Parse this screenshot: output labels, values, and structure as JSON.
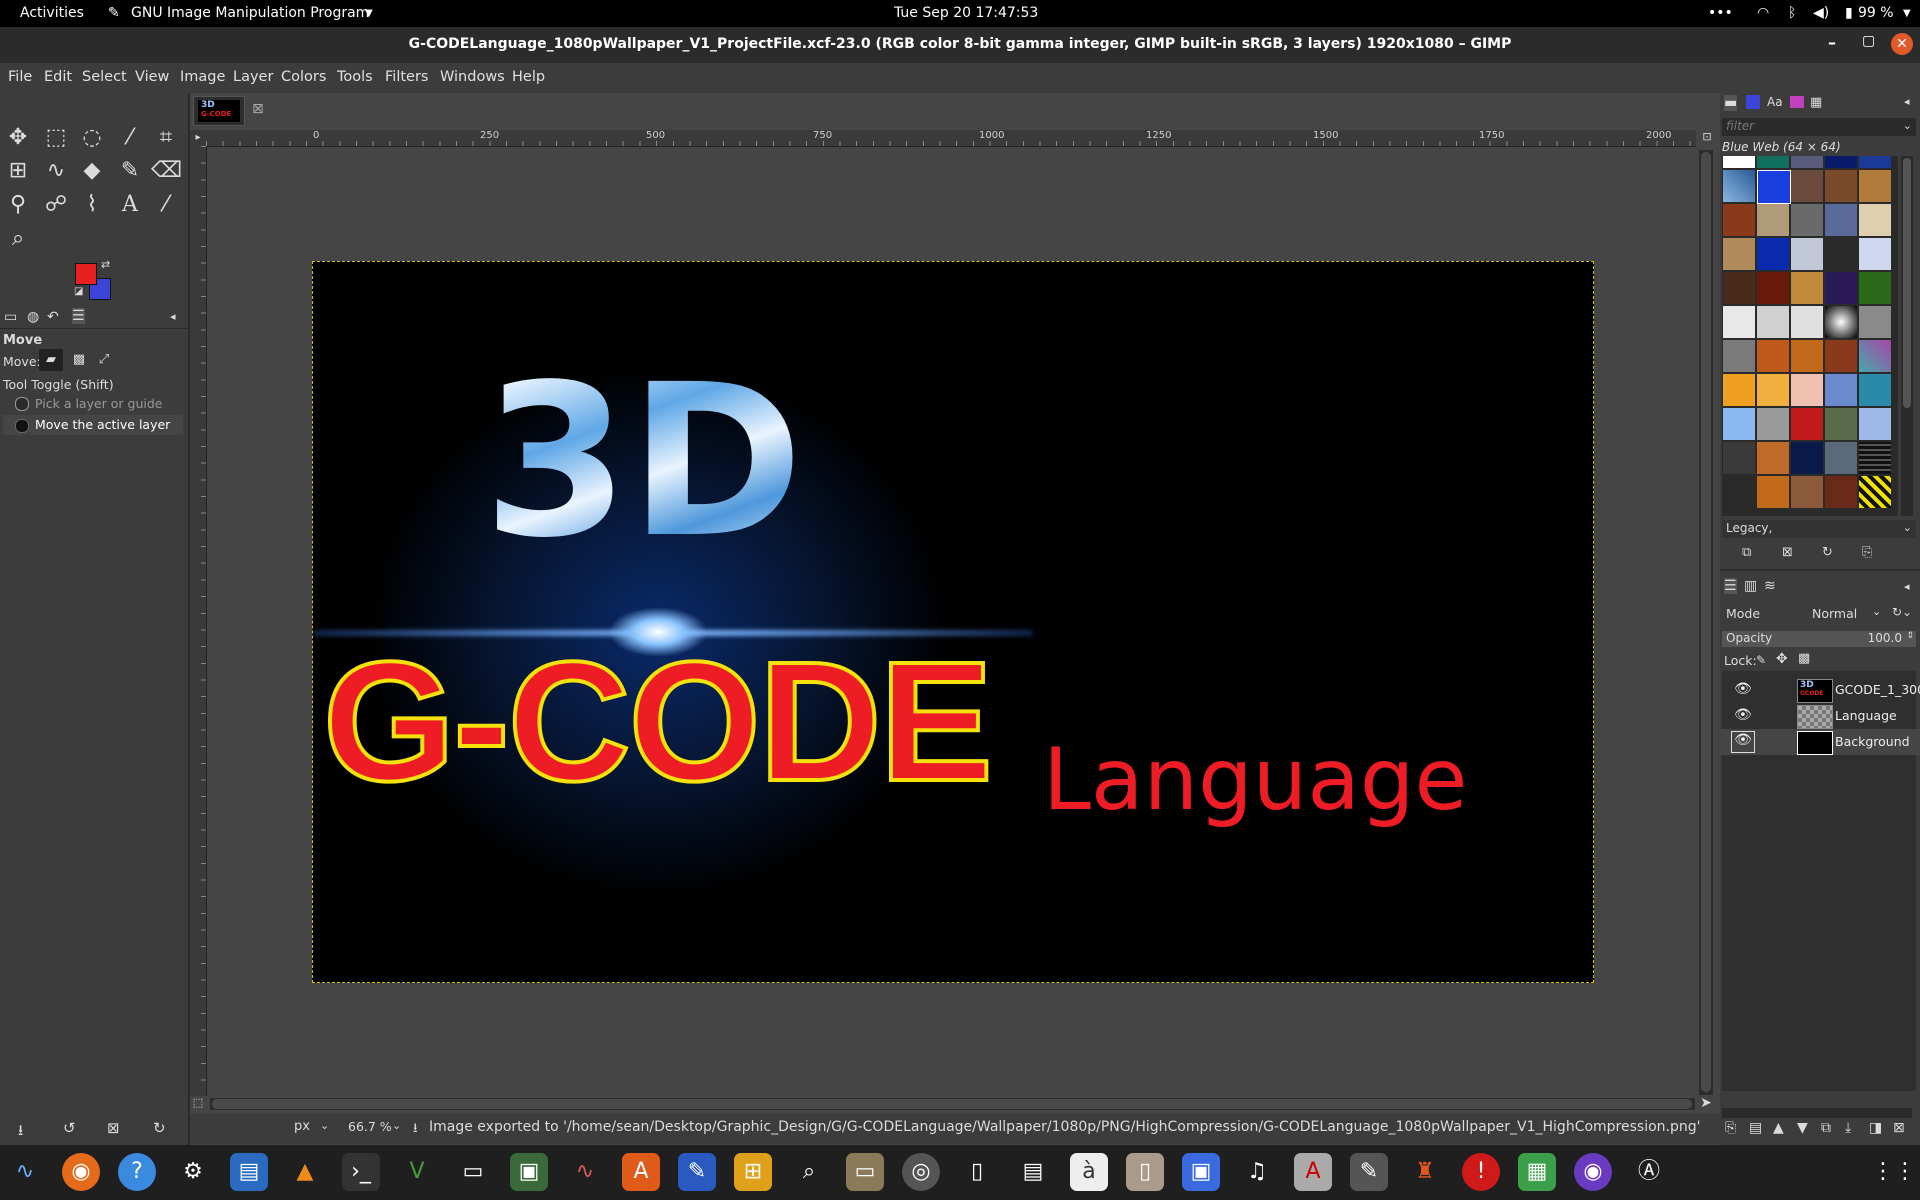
{
  "topbar": {
    "activities": "Activities",
    "app_name": "GNU Image Manipulation Program",
    "clock": "Tue Sep 20  17:47:53",
    "battery": "99 %"
  },
  "window": {
    "title": "G-CODELanguage_1080pWallpaper_V1_ProjectFile.xcf-23.0 (RGB color 8-bit gamma integer, GIMP built-in sRGB, 3 layers) 1920x1080 – GIMP"
  },
  "menu": [
    "File",
    "Edit",
    "Select",
    "View",
    "Image",
    "Layer",
    "Colors",
    "Tools",
    "Filters",
    "Windows",
    "Help"
  ],
  "colors": {
    "fg": "#e82020",
    "bg": "#3b45d8",
    "accent": "#d6c300"
  },
  "tool_options": {
    "title": "Move",
    "move_label": "Move:",
    "toggle_label": "Tool Toggle  (Shift)",
    "opt1": "Pick a layer or guide",
    "opt2": "Move the active layer"
  },
  "ruler": {
    "labels": [
      "0",
      "250",
      "500",
      "750",
      "1000",
      "1250",
      "1500",
      "1750",
      "2000"
    ]
  },
  "canvas": {
    "line1": "3D",
    "line2": "G-CODE",
    "line3": "Language"
  },
  "patterns": {
    "filter_placeholder": "filter",
    "current": "Blue Web (64 × 64)",
    "tag": "Legacy,"
  },
  "layers": {
    "mode_label": "Mode",
    "mode_value": "Normal",
    "opacity_label": "Opacity",
    "opacity_value": "100.0",
    "lock_label": "Lock:",
    "items": [
      {
        "name": "GCODE_1_300"
      },
      {
        "name": "Language"
      },
      {
        "name": "Background"
      }
    ]
  },
  "status": {
    "unit": "px",
    "zoom": "66.7 %",
    "message": "Image exported to '/home/sean/Desktop/Graphic_Design/G/G-CODELanguage/Wallpaper/1080p/PNG/HighCompression/G-CODELanguage_1080pWallpaper_V1_HighCompression.png'"
  }
}
